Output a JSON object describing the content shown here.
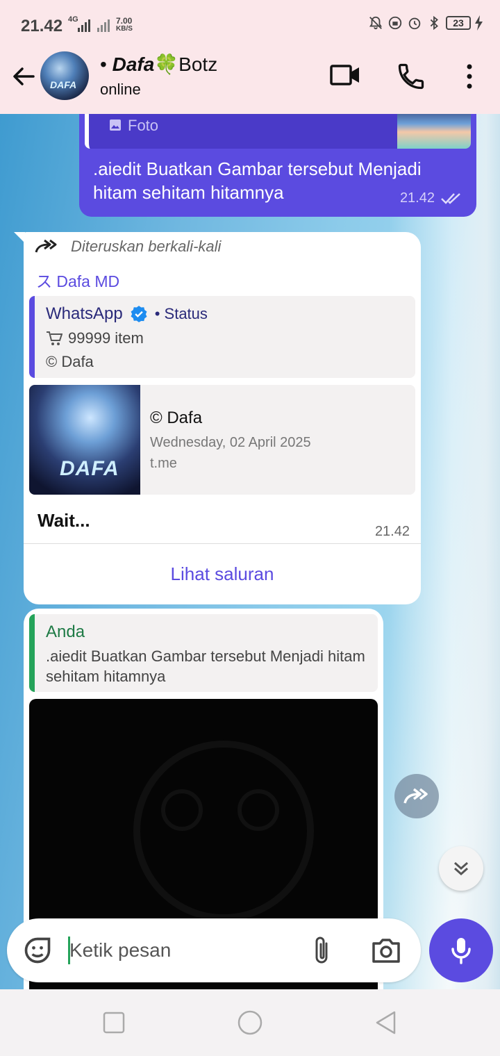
{
  "status_bar": {
    "time": "21.42",
    "network": "4G",
    "speed_value": "7.00",
    "speed_unit": "KB/S",
    "battery": "23"
  },
  "header": {
    "contact_name_prefix": "• ",
    "contact_name_bold": "Dafa",
    "contact_name_emoji": "🍀",
    "contact_name_suffix": "Botz",
    "status": "online",
    "avatar_text": "DAFA"
  },
  "sent_message": {
    "quoted_label": "Foto",
    "text": ".aiedit Buatkan Gambar tersebut Menjadi hitam sehitam hitamnya",
    "time": "21.42"
  },
  "channel_message": {
    "forwarded_label": "Diteruskan berkali-kali",
    "channel_name": "Dafa MD",
    "card_title": "WhatsApp",
    "card_subtitle": "• Status",
    "items": "99999 item",
    "copyright": "© Dafa",
    "link_title": "© Dafa",
    "link_date": "Wednesday, 02 April 2025",
    "link_domain": "t.me",
    "thumb_text": "DAFA",
    "body": "Wait...",
    "time": "21.42",
    "action": "Lihat saluran"
  },
  "reply_message": {
    "quoted_author": "Anda",
    "quoted_text": ".aiedit Buatkan Gambar tersebut Menjadi hitam sehitam hitamnya"
  },
  "input": {
    "placeholder": "Ketik pesan"
  },
  "colors": {
    "accent": "#5b4be0",
    "header_bg": "#fbe7ea",
    "quote_green": "#25a35a",
    "verified_blue": "#1d8cf0"
  }
}
